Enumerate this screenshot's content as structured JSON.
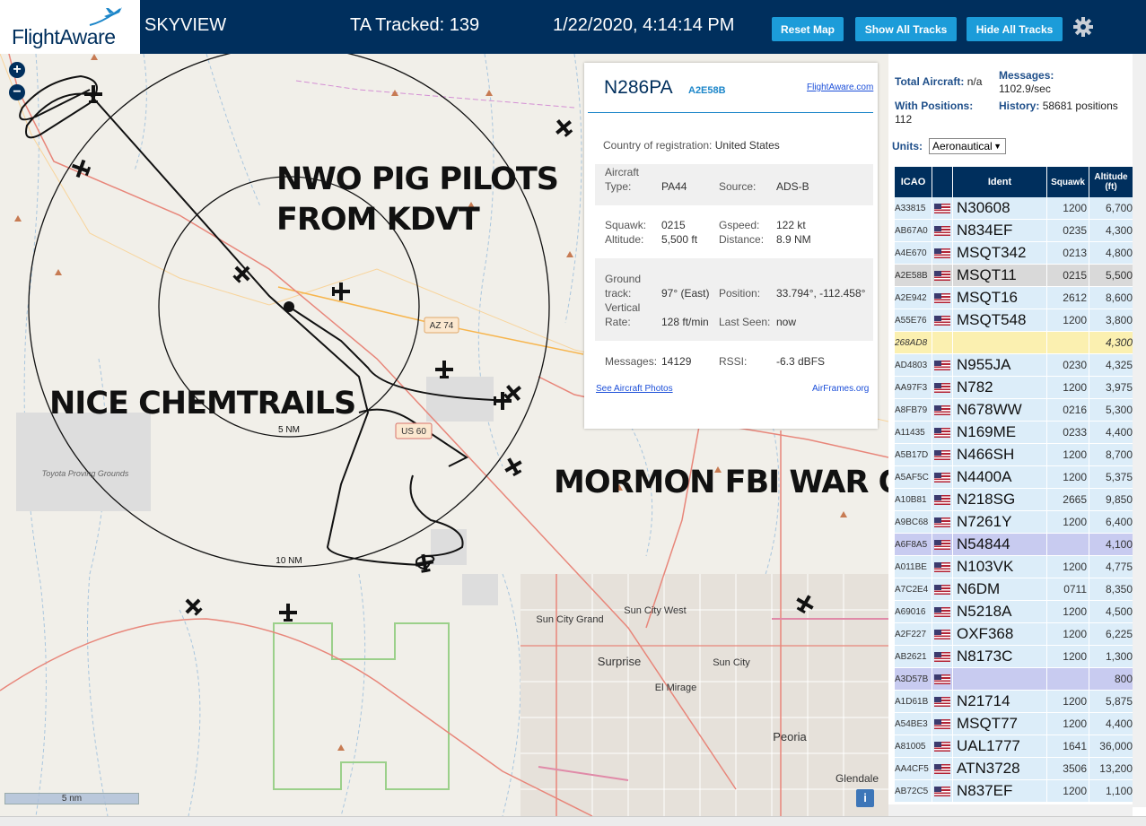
{
  "header": {
    "logo_text": "FlightAware",
    "app_name": "SKYVIEW",
    "tracked": "TA Tracked: 139",
    "datetime": "1/22/2020, 4:14:14 PM",
    "buttons": {
      "reset": "Reset Map",
      "show": "Show All Tracks",
      "hide": "Hide All Tracks"
    },
    "settings_icon": "gear-icon"
  },
  "map": {
    "zoom_in": "+",
    "zoom_out": "−",
    "overlays": {
      "line1": "NWO PIG PILOTS",
      "line2": "FROM KDVT",
      "chemtrails": "NICE CHEMTRAILS",
      "mormon": "MORMON FBI WAR ON AZ"
    },
    "range_labels": {
      "inner": "5 NM",
      "outer": "10 NM"
    },
    "road_labels": {
      "az74": "AZ 74",
      "us60": "US 60"
    },
    "place_labels": {
      "toyota": "Toyota Proving Grounds",
      "sun_city_grand": "Sun City Grand",
      "sun_city_west": "Sun City West",
      "surprise": "Surprise",
      "sun_city": "Sun City",
      "el_mirage": "El Mirage",
      "peoria": "Peoria",
      "glendale": "Glendale"
    },
    "scale": "5 nm",
    "info": "i"
  },
  "popup": {
    "ident": "N286PA",
    "icao": "A2E58B",
    "link": "FlightAware.com",
    "country_label": "Country of registration:",
    "country": "United States",
    "type_label1": "Aircraft",
    "type_label2": "Type:",
    "type": "PA44",
    "source_label": "Source:",
    "source": "ADS-B",
    "squawk_label": "Squawk:",
    "squawk": "0215",
    "gspeed_label": "Gspeed:",
    "gspeed": "122 kt",
    "altitude_label": "Altitude:",
    "altitude": "5,500 ft",
    "distance_label": "Distance:",
    "distance": "8.9 NM",
    "ground_label1": "Ground",
    "ground_label2": "track:",
    "ground": "97° (East)",
    "position_label": "Position:",
    "position": "33.794°, -112.458°",
    "vert_label1": "Vertical",
    "vert_label2": "Rate:",
    "vert": "128 ft/min",
    "lastseen_label": "Last Seen:",
    "lastseen": "now",
    "messages_label": "Messages:",
    "messages": "14129",
    "rssi_label": "RSSI:",
    "rssi": "-6.3 dBFS",
    "photos_link": "See Aircraft Photos",
    "airframes_link": "AirFrames.org"
  },
  "sidebar": {
    "total_label": "Total Aircraft:",
    "total": "n/a",
    "messages_label": "Messages:",
    "messages": "1102.9/sec",
    "positions_label": "With Positions:",
    "positions": "112",
    "history_label": "History:",
    "history": "58681 positions",
    "units_label": "Units:",
    "units": "Aeronautical",
    "columns": {
      "icao": "ICAO",
      "ident": "Ident",
      "squawk": "Squawk",
      "alt1": "Altitude",
      "alt2": "(ft)"
    },
    "rows": [
      {
        "icao": "A33815",
        "ident": "N30608",
        "squawk": "1200",
        "alt": "6,700"
      },
      {
        "icao": "AB67A0",
        "ident": "N834EF",
        "squawk": "0235",
        "alt": "4,300"
      },
      {
        "icao": "A4E670",
        "ident": "MSQT342",
        "squawk": "0213",
        "alt": "4,800"
      },
      {
        "icao": "A2E58B",
        "ident": "MSQT11",
        "squawk": "0215",
        "alt": "5,500"
      },
      {
        "icao": "A2E942",
        "ident": "MSQT16",
        "squawk": "2612",
        "alt": "8,600"
      },
      {
        "icao": "A55E76",
        "ident": "MSQT548",
        "squawk": "1200",
        "alt": "3,800"
      },
      {
        "icao": "268AD8",
        "ident": "",
        "squawk": "",
        "alt": "4,300"
      },
      {
        "icao": "AD4803",
        "ident": "N955JA",
        "squawk": "0230",
        "alt": "4,325"
      },
      {
        "icao": "AA97F3",
        "ident": "N782",
        "squawk": "1200",
        "alt": "3,975"
      },
      {
        "icao": "A8FB79",
        "ident": "N678WW",
        "squawk": "0216",
        "alt": "5,300"
      },
      {
        "icao": "A11435",
        "ident": "N169ME",
        "squawk": "0233",
        "alt": "4,400"
      },
      {
        "icao": "A5B17D",
        "ident": "N466SH",
        "squawk": "1200",
        "alt": "8,700"
      },
      {
        "icao": "A5AF5C",
        "ident": "N4400A",
        "squawk": "1200",
        "alt": "5,375"
      },
      {
        "icao": "A10B81",
        "ident": "N218SG",
        "squawk": "2665",
        "alt": "9,850"
      },
      {
        "icao": "A9BC68",
        "ident": "N7261Y",
        "squawk": "1200",
        "alt": "6,400"
      },
      {
        "icao": "A6F8A5",
        "ident": "N54844",
        "squawk": "",
        "alt": "4,100"
      },
      {
        "icao": "A011BE",
        "ident": "N103VK",
        "squawk": "1200",
        "alt": "4,775"
      },
      {
        "icao": "A7C2E4",
        "ident": "N6DM",
        "squawk": "0711",
        "alt": "8,350"
      },
      {
        "icao": "A69016",
        "ident": "N5218A",
        "squawk": "1200",
        "alt": "4,500"
      },
      {
        "icao": "A2F227",
        "ident": "OXF368",
        "squawk": "1200",
        "alt": "6,225"
      },
      {
        "icao": "AB2621",
        "ident": "N8173C",
        "squawk": "1200",
        "alt": "1,300"
      },
      {
        "icao": "A3D57B",
        "ident": "",
        "squawk": "",
        "alt": "800"
      },
      {
        "icao": "A1D61B",
        "ident": "N21714",
        "squawk": "1200",
        "alt": "5,875"
      },
      {
        "icao": "A54BE3",
        "ident": "MSQT77",
        "squawk": "1200",
        "alt": "4,400"
      },
      {
        "icao": "A81005",
        "ident": "UAL1777",
        "squawk": "1641",
        "alt": "36,000"
      },
      {
        "icao": "AA4CF5",
        "ident": "ATN3728",
        "squawk": "3506",
        "alt": "13,200"
      },
      {
        "icao": "AB72C5",
        "ident": "N837EF",
        "squawk": "1200",
        "alt": "1,100"
      }
    ]
  },
  "colors": {
    "navy": "#002f5d",
    "button_blue": "#1c9cd9",
    "row_blue": "#dcedf9",
    "row_selected": "#d9d9d9",
    "row_no_position": "#c8cbf0",
    "row_non_us": "#fbf0b0"
  }
}
